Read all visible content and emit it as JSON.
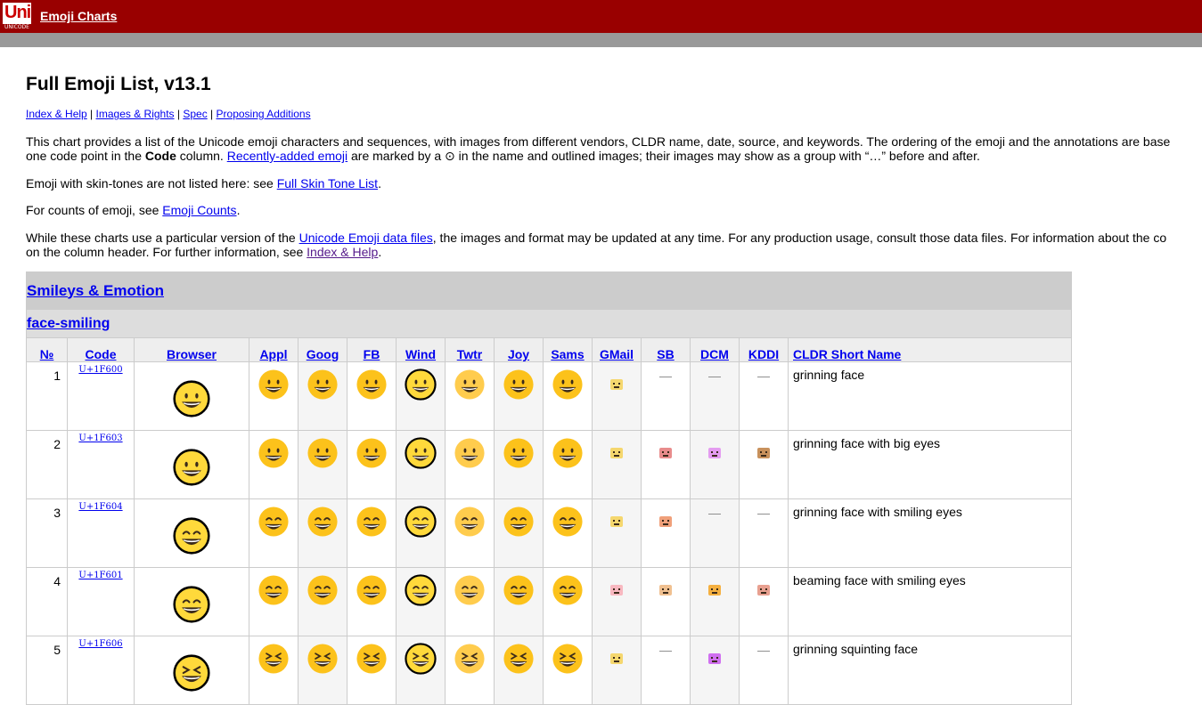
{
  "header": {
    "logo_text": "Uni",
    "logo_sub": "UNICODE",
    "site_title": "Emoji Charts"
  },
  "page": {
    "title": "Full Emoji List, v13.1",
    "nav": [
      "Index & Help",
      "Images & Rights",
      "Spec",
      "Proposing Additions"
    ],
    "p1": {
      "a": "This chart provides a list of the Unicode emoji characters and sequences, with images from different vendors, CLDR name, date, source, and keywords. The ordering of the emoji and the annotations are base",
      "b1": "one code point in the ",
      "b_code": "Code",
      "b2": " column. ",
      "b_link": "Recently-added emoji",
      "b3": " are marked by a ⊙ in the name and outlined images; their images may show as a group with “…” before and after."
    },
    "p2": {
      "a": "Emoji with skin-tones are not listed here: see ",
      "link": "Full Skin Tone List",
      "b": "."
    },
    "p3": {
      "a": "For counts of emoji, see ",
      "link": "Emoji Counts",
      "b": "."
    },
    "p4": {
      "a": "While these charts use a particular version of the ",
      "link": "Unicode Emoji data files",
      "b": ", the images and format may be updated at any time. For any production usage, consult those data files. For information about the co",
      "c": "on the column header. For further information, see ",
      "link2": "Index & Help",
      "d": "."
    }
  },
  "table": {
    "bighead": "Smileys & Emotion",
    "mediumhead": "face-smiling",
    "columns": [
      "№",
      "Code",
      "Browser",
      "Appl",
      "Goog",
      "FB",
      "Wind",
      "Twtr",
      "Joy",
      "Sams",
      "GMail",
      "SB",
      "DCM",
      "KDDI",
      "CLDR Short Name"
    ],
    "rows": [
      {
        "num": "1",
        "code": "U+1F600",
        "name": "grinning face"
      },
      {
        "num": "2",
        "code": "U+1F603",
        "name": "grinning face with big eyes"
      },
      {
        "num": "3",
        "code": "U+1F604",
        "name": "grinning face with smiling eyes"
      },
      {
        "num": "4",
        "code": "U+1F601",
        "name": "beaming face with smiling eyes"
      },
      {
        "num": "5",
        "code": "U+1F606",
        "name": "grinning squinting face"
      }
    ],
    "dash": "—"
  },
  "colors": {
    "header_red": "#990000",
    "gray_bar": "#999999",
    "link": "#0000ee",
    "emoji_yellow": "#fcc21b"
  }
}
